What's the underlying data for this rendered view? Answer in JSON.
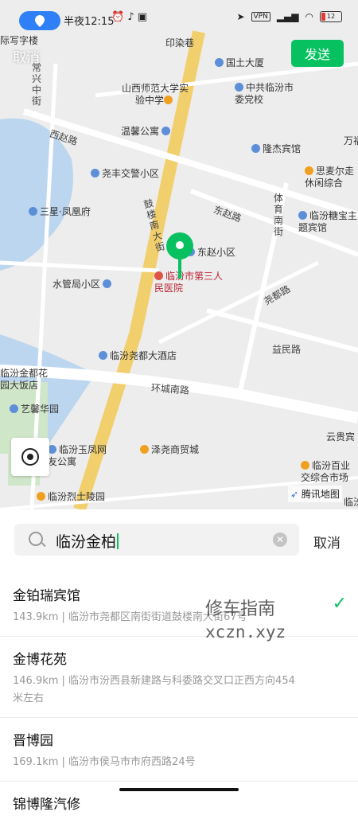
{
  "status_bar": {
    "time": "半夜12:15",
    "vpn": "VPN",
    "battery": "12"
  },
  "top": {
    "cancel_label": "取消",
    "send_label": "发送"
  },
  "map": {
    "labels": [
      "际写字楼",
      "印染巷",
      "国土大厦",
      "常兴中街",
      "山西师范大学实验中学",
      "中共临汾市委党校",
      "西赵路",
      "温馨公寓",
      "隆杰宾馆",
      "万福",
      "尧丰交警小区",
      "思麦尔走休闲综合",
      "三星·凤凰府",
      "东赵路",
      "体育南街",
      "临汾糖宝主题宾馆",
      "鼓楼南大街",
      "东赵小区",
      "水管局小区",
      "临汾市第三人民医院",
      "尧都路",
      "益民路",
      "临汾尧都大酒店",
      "临汾金都花园大饭店",
      "环城南路",
      "艺馨华园",
      "云贵宾",
      "临汾玉凤网友公寓",
      "泽尧商贸城",
      "临汾百业交综合市场",
      "临汾烈士陵园",
      "临汾"
    ],
    "attribution": "腾讯地图"
  },
  "search": {
    "query": "临汾金柏",
    "cancel_label": "取消"
  },
  "results": [
    {
      "name": "金铂瑞宾馆",
      "detail": "143.9km | 临汾市尧都区南街街道鼓楼南大街67号",
      "selected": true
    },
    {
      "name": "金博花苑",
      "detail": "146.9km | 临汾市汾西县新建路与科委路交叉口正西方向454米左右",
      "selected": false
    },
    {
      "name": "晋博园",
      "detail": "169.1km | 临汾市侯马市市府西路24号",
      "selected": false
    },
    {
      "name": "锦博隆汽修",
      "detail": "",
      "selected": false
    }
  ],
  "watermark": {
    "line1": "修车指南",
    "line2": "xczn.xyz"
  }
}
